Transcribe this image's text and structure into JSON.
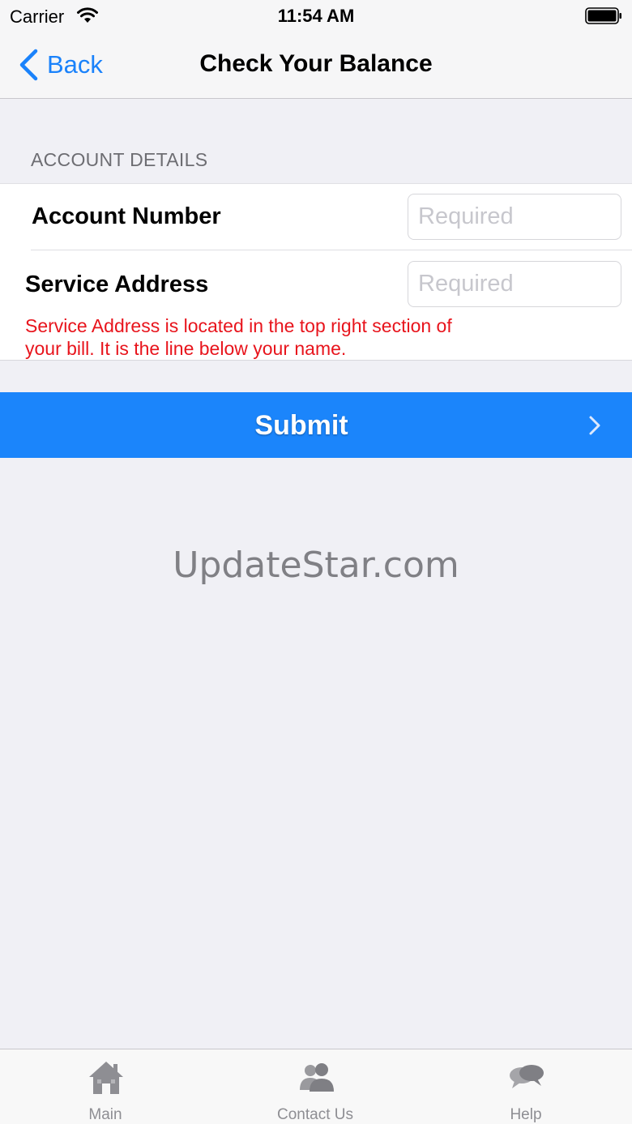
{
  "status_bar": {
    "carrier": "Carrier",
    "time": "11:54 AM"
  },
  "nav": {
    "back_label": "Back",
    "title": "Check Your Balance"
  },
  "form": {
    "section_header": "ACCOUNT DETAILS",
    "account_number": {
      "label": "Account Number",
      "placeholder": "Required",
      "value": ""
    },
    "service_address": {
      "label": "Service Address",
      "placeholder": "Required",
      "value": ""
    },
    "hint": "Service Address is located in the top right section of your bill. It is the line below your name."
  },
  "submit": {
    "label": "Submit"
  },
  "watermark": "UpdateStar.com",
  "tabs": [
    {
      "label": "Main",
      "icon": "house-icon"
    },
    {
      "label": "Contact Us",
      "icon": "people-icon"
    },
    {
      "label": "Help",
      "icon": "speech-bubbles-icon"
    }
  ],
  "colors": {
    "accent": "#1a82fb",
    "submit_bg": "#1b85fb",
    "hint_text": "#e8141c",
    "background": "#f0f0f5"
  }
}
